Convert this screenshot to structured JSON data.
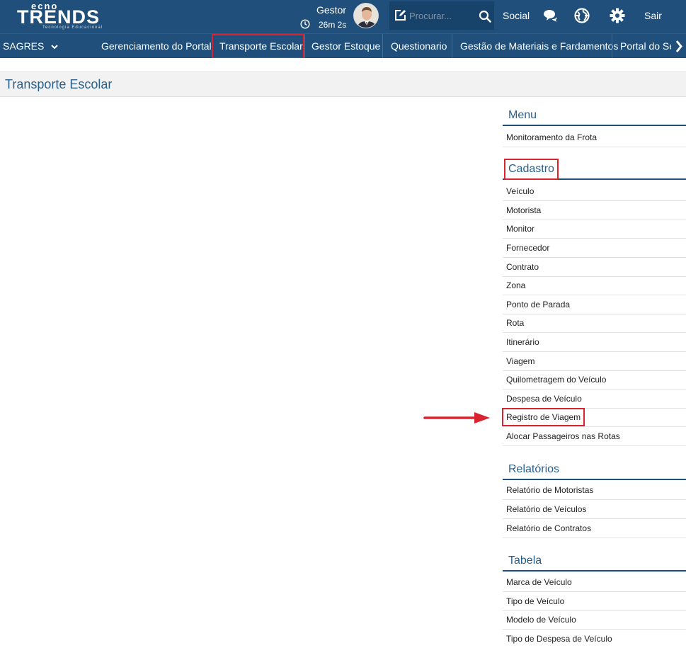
{
  "header": {
    "logo": "TECNO TRENDS",
    "logo_tagline": "Tecnologia Educacional",
    "user_name": "Gestor",
    "session_time": "26m 2s",
    "search_placeholder": "Procurar...",
    "social_label": "Social",
    "logout_label": "Sair",
    "icons": [
      "pencil-square-icon",
      "search-icon",
      "chat-bubbles-icon",
      "globe-icon",
      "gear-icon",
      "clock-icon"
    ]
  },
  "nav": {
    "sagres": "SAGRES",
    "items": [
      {
        "label": "Gerenciamento do Portal"
      },
      {
        "label": "Transporte Escolar",
        "highlighted": true
      },
      {
        "label": "Gestor Estoque"
      },
      {
        "label": "Questionario"
      },
      {
        "label": "Gestão de Materiais e Fardamentos"
      },
      {
        "label": "Portal do Servidor"
      }
    ]
  },
  "page": {
    "title": "Transporte Escolar"
  },
  "sidebar": {
    "menu": {
      "title": "Menu",
      "items": [
        "Monitoramento da Frota"
      ]
    },
    "cadastro": {
      "title": "Cadastro",
      "items": [
        "Veículo",
        "Motorista",
        "Monitor",
        "Fornecedor",
        "Contrato",
        "Zona",
        "Ponto de Parada",
        "Rota",
        "Itinerário",
        "Viagem",
        "Quilometragem do Veículo",
        "Despesa de Veículo",
        "Registro de Viagem",
        "Alocar Passageiros nas Rotas"
      ]
    },
    "relatorios": {
      "title": "Relatórios",
      "items": [
        "Relatório de Motoristas",
        "Relatório de Veículos",
        "Relatório de Contratos"
      ]
    },
    "tabela": {
      "title": "Tabela",
      "items": [
        "Marca de Veículo",
        "Tipo de Veículo",
        "Modelo de Veículo",
        "Tipo de Despesa de Veículo"
      ]
    }
  },
  "colors": {
    "brand": "#1f4f7a",
    "highlight": "#d9232e",
    "heading": "#2a5f8a"
  }
}
